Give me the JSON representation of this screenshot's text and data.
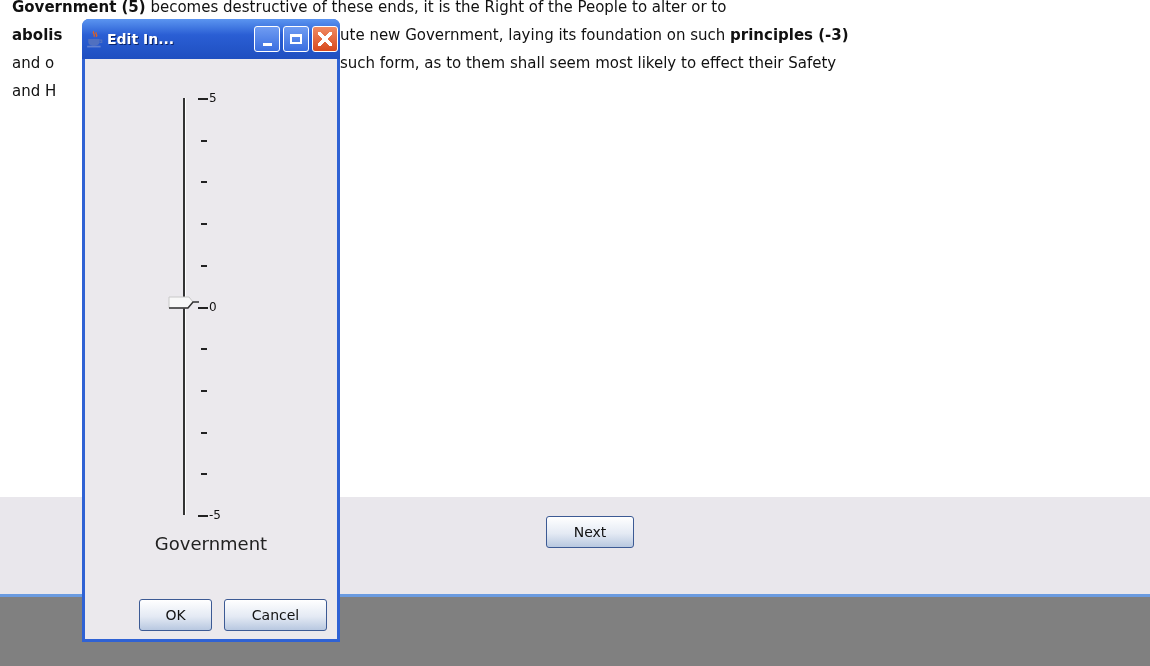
{
  "document": {
    "lines": [
      {
        "segments": [
          "**Government (5)** becomes destructive of these ends, it is the Right of the People to alter or to"
        ]
      },
      {
        "segments": [
          "**abolis**",
          "ute new Government, laying its foundation on such **principles (-3)**"
        ]
      },
      {
        "segments": [
          "and o",
          "such form, as to them shall seem most likely to effect their Safety"
        ]
      },
      {
        "segments": [
          "and H"
        ]
      }
    ]
  },
  "navigation": {
    "next_button": "Next"
  },
  "dialog": {
    "title": "Edit In...",
    "slider": {
      "label": "Government",
      "level": 0.5,
      "tick_labels": [
        "5",
        "0",
        "-5"
      ]
    },
    "buttons": [
      "OK",
      "Cancel"
    ]
  }
}
